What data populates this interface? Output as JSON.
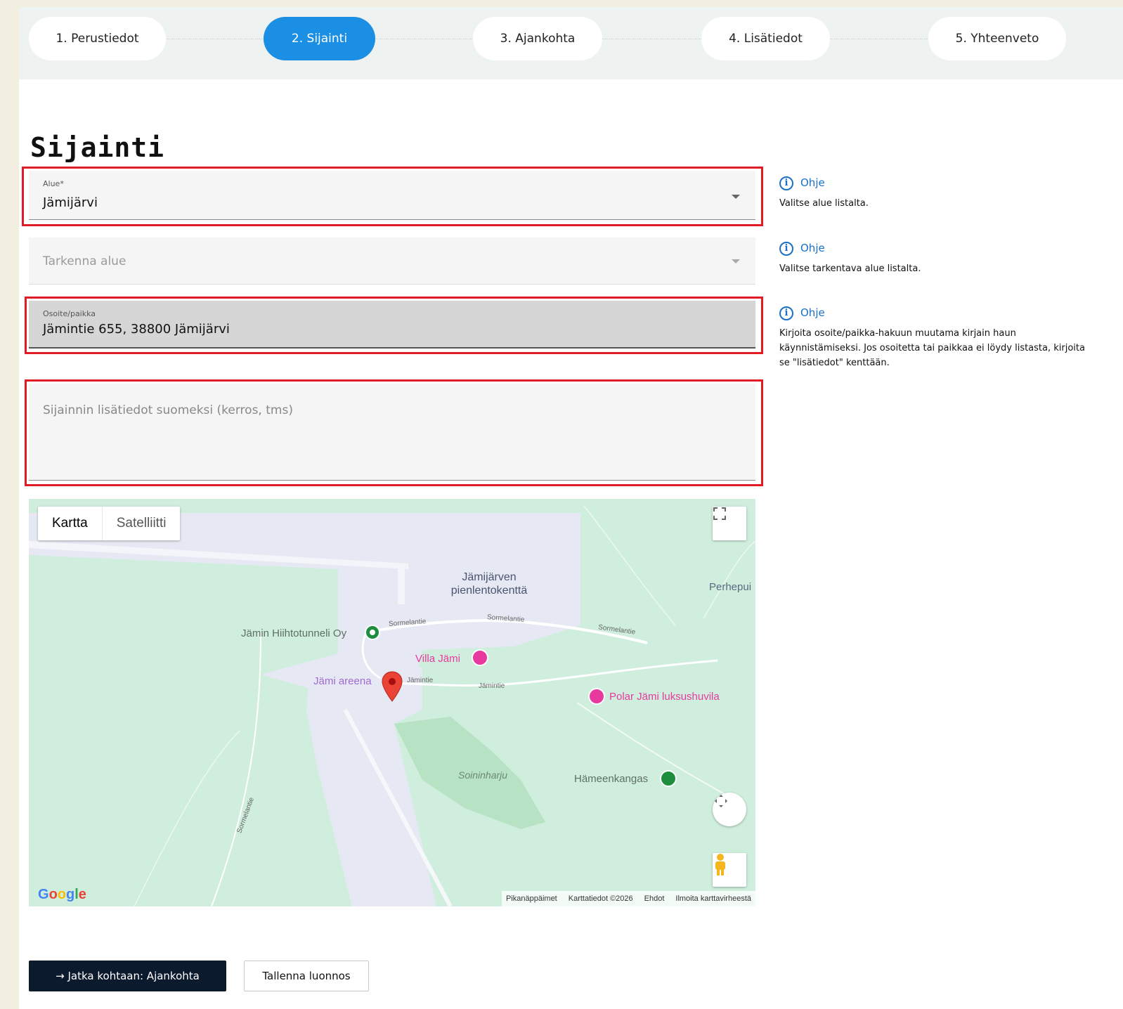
{
  "stepper": {
    "steps": [
      {
        "label": "1. Perustiedot"
      },
      {
        "label": "2. Sijainti"
      },
      {
        "label": "3. Ajankohta"
      },
      {
        "label": "4. Lisätiedot"
      },
      {
        "label": "5. Yhteenveto"
      }
    ],
    "active_step": 2
  },
  "page_title": "Sijainti",
  "fields": {
    "alue": {
      "label": "Alue*",
      "value": "Jämijärvi"
    },
    "tarkenna": {
      "placeholder": "Tarkenna alue"
    },
    "osoite": {
      "label": "Osoite/paikka",
      "value": "Jämintie 655, 38800 Jämijärvi"
    },
    "lisatiedot": {
      "placeholder": "Sijainnin lisätiedot suomeksi (kerros, tms)"
    }
  },
  "help": [
    {
      "link": "Ohje",
      "text": "Valitse alue listalta."
    },
    {
      "link": "Ohje",
      "text": "Valitse tarkentava alue listalta."
    },
    {
      "link": "Ohje",
      "text": "Kirjoita osoite/paikka-hakuun muutama kirjain haun käynnistämiseksi. Jos osoitetta tai paikkaa ei löydy listasta, kirjoita se \"lisätiedot\" kenttään."
    }
  ],
  "map": {
    "type_buttons": {
      "map": "Kartta",
      "satellite": "Satelliitti"
    },
    "labels": {
      "airfield": "Jämijärven pienlentokenttä",
      "perhe": "Perhepui",
      "hiihtotunneli": "Jämin Hiihtotunneli Oy",
      "villa": "Villa Jämi",
      "areena": "Jämi areena",
      "polar": "Polar Jämi luksushuvila",
      "soininharju": "Soininharju",
      "hameenkangas": "Hämeenkangas",
      "road1": "Sormelantie",
      "road2": "Sormelantie",
      "road3": "Sormelantie",
      "road4": "Jämintie",
      "road5": "Jämintie",
      "road6": "Sormelantie"
    },
    "logo": "Google",
    "attribution": [
      "Pikanäppäimet",
      "Karttatiedot ©2026",
      "Ehdot",
      "Ilmoita karttavirheestä"
    ],
    "colors": {
      "land": "#cfeedd",
      "airfield": "#e8eaf4",
      "park": "#b7e2c3",
      "pin": "#ea4335",
      "poi_pink": "#e8399e",
      "poi_green": "#1e8e3e"
    }
  },
  "buttons": {
    "continue": "→  Jatka kohtaan: Ajankohta",
    "save_draft": "Tallenna luonnos"
  },
  "colors": {
    "accent": "#1a8fe3",
    "highlight": "#e01b24",
    "primary_button": "#0c1a2e"
  }
}
